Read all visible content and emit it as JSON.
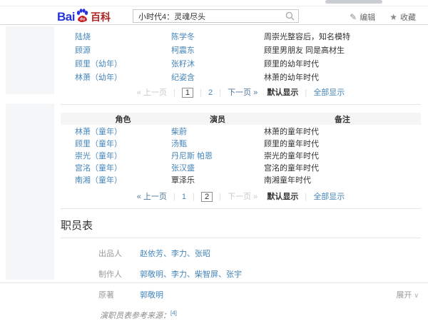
{
  "colors": {
    "link_blue": "#4585ba",
    "baidu_blue": "#2534dc",
    "baike_red": "#b02320"
  },
  "header": {
    "logo_bai": "Bai",
    "logo_du": "du",
    "logo_suffix": "百科",
    "search_value": "小时代4：灵魂尽头",
    "action_edit": "编辑",
    "action_fav": "收藏"
  },
  "icons": {
    "edit": "✎",
    "fav": "★",
    "chevron": "∨"
  },
  "table1": {
    "rows": [
      {
        "role": "陆烧",
        "actor": "陈学冬",
        "note": "周崇光整容后，知名模特"
      },
      {
        "role": "顾源",
        "actor": "柯震东",
        "note": "顾里男朋友 同是高材生"
      },
      {
        "role": "顾里（幼年）",
        "actor": "张籽沐",
        "note": "顾里的幼年时代"
      },
      {
        "role": "林萧（幼年）",
        "actor": "纪姿含",
        "note": "林萧的幼年时代"
      }
    ],
    "pagination": {
      "prev": "« 上一页",
      "page1": "1",
      "page2": "2",
      "next": "下一页 »",
      "sep": "|",
      "mode_default": "默认显示",
      "mode_all": "全部显示"
    }
  },
  "table2": {
    "col_role": "角色",
    "col_actor": "演员",
    "col_note": "备注",
    "rows": [
      {
        "role": "林萧（童年）",
        "actor": "柴蔚",
        "note": "林萧的童年时代"
      },
      {
        "role": "顾里（童年）",
        "actor": "汤甄",
        "note": "顾里的童年时代"
      },
      {
        "role": "崇光（童年）",
        "actor": "丹尼斯 帕恩",
        "note": "崇光的童年时代"
      },
      {
        "role": "宫洺（童年）",
        "actor": "张汉盛",
        "note": "宫洺的童年时代"
      },
      {
        "role": "南湘（童年）",
        "actor": "覃泽乐",
        "note": "南湘童年时代"
      }
    ],
    "pagination": {
      "prev": "« 上一页",
      "page1": "1",
      "page2": "2",
      "next": "下一页 »",
      "sep": "|",
      "mode_default": "默认显示",
      "mode_all": "全部显示"
    }
  },
  "staff": {
    "title": "职员表",
    "rows": [
      {
        "label": "出品人",
        "value": "赵依芳、李力、张昭"
      },
      {
        "label": "制作人",
        "value": "郭敬明、李力、柴智屏、张宇"
      },
      {
        "label": "原著",
        "value": "郭敬明"
      }
    ],
    "expand_label": "展开",
    "source_note": "演职员表参考来源：",
    "source_ref": "[4]"
  }
}
